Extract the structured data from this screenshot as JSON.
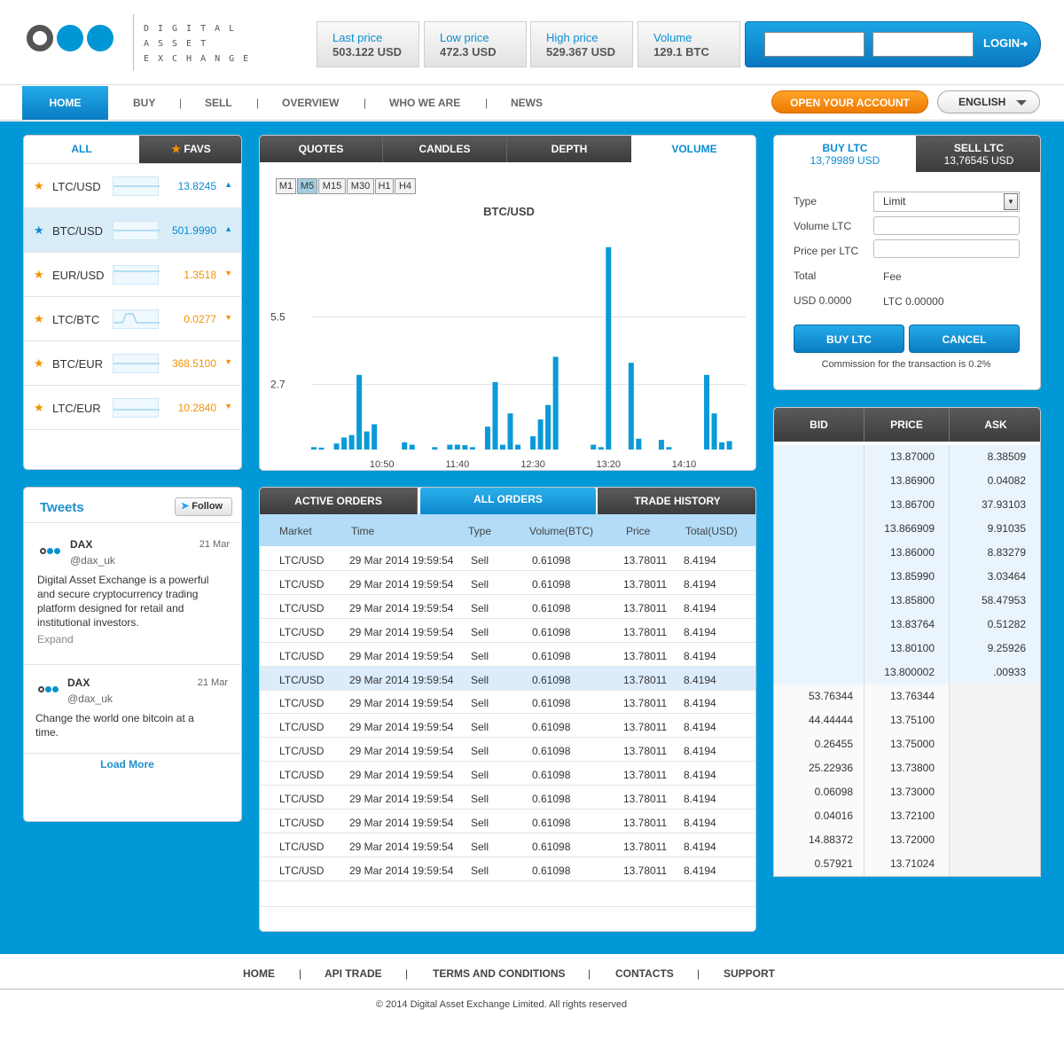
{
  "brand": {
    "logo_lines": [
      "DIGITAL",
      "ASSET",
      "EXCHANGE"
    ]
  },
  "stats": [
    {
      "label": "Last price",
      "value": "503.122 USD"
    },
    {
      "label": "Low price",
      "value": "472.3 USD"
    },
    {
      "label": "High price",
      "value": "529.367 USD"
    },
    {
      "label": "Volume",
      "value": "129.1 BTC"
    }
  ],
  "login": {
    "button": "LOGIN",
    "arrow_icon": "arrow-right-icon"
  },
  "nav": {
    "home": "HOME",
    "items": [
      "BUY",
      "SELL",
      "OVERVIEW",
      "WHO WE ARE",
      "NEWS"
    ],
    "separator": "|",
    "open_account": "OPEN YOUR ACCOUNT",
    "language": "ENGLISH"
  },
  "markets": {
    "tabs": {
      "all": "ALL",
      "favs": "FAVS"
    },
    "rows": [
      {
        "pair": "LTC/USD",
        "price": "13.8245",
        "dir": "up"
      },
      {
        "pair": "BTC/USD",
        "price": "501.9990",
        "dir": "up"
      },
      {
        "pair": "EUR/USD",
        "price": "1.3518",
        "dir": "down"
      },
      {
        "pair": "LTC/BTC",
        "price": "0.0277",
        "dir": "down"
      },
      {
        "pair": "BTC/EUR",
        "price": "368.5100",
        "dir": "down"
      },
      {
        "pair": "LTC/EUR",
        "price": "10.2840",
        "dir": "down"
      }
    ],
    "colors": {
      "up": "#0b8cd1",
      "down": "#f39200",
      "star": "#f39200",
      "star_selected": "#0b8cd1"
    }
  },
  "tweets": {
    "title": "Tweets",
    "follow": "Follow",
    "items": [
      {
        "name": "DAX",
        "handle": "@dax_uk",
        "date": "21 Mar",
        "text_lines": [
          "Digital Asset Exchange is a powerful",
          "and secure cryptocurrency trading",
          "platform designed for retail and",
          "institutional investors."
        ],
        "expand": "Expand"
      },
      {
        "name": "DAX",
        "handle": "@dax_uk",
        "date": "21 Mar",
        "text_lines": [
          "Change the world one bitcoin at a",
          "time."
        ],
        "expand": ""
      }
    ],
    "load_more": "Load More"
  },
  "chart_tabs": [
    "QUOTES",
    "CANDLES",
    "DEPTH",
    "VOLUME"
  ],
  "timeframes": [
    "M1",
    "M5",
    "M15",
    "M30",
    "H1",
    "H4"
  ],
  "timeframe_active": "M5",
  "chart_data": {
    "type": "bar",
    "title": "BTC/USD",
    "xlabel": "",
    "ylabel": "",
    "ylim": [
      0,
      9.2
    ],
    "yticks": [
      2.7,
      5.5
    ],
    "xticks": [
      {
        "label": "10:50",
        "t": 9
      },
      {
        "label": "11:40",
        "t": 19
      },
      {
        "label": "12:30",
        "t": 29
      },
      {
        "label": "13:20",
        "t": 39
      },
      {
        "label": "14:10",
        "t": 49
      }
    ],
    "grid": true,
    "x": [
      0,
      1,
      3,
      4,
      5,
      6,
      7,
      8,
      12,
      13,
      16,
      18,
      19,
      20,
      21,
      23,
      24,
      25,
      26,
      27,
      29,
      30,
      31,
      32,
      37,
      38,
      39,
      42,
      43,
      46,
      47,
      52,
      53,
      54,
      55
    ],
    "values": [
      0.1,
      0.08,
      0.25,
      0.5,
      0.6,
      3.1,
      0.75,
      1.05,
      0.3,
      0.2,
      0.1,
      0.2,
      0.2,
      0.18,
      0.1,
      0.95,
      2.8,
      0.2,
      1.5,
      0.2,
      0.55,
      1.25,
      1.85,
      3.85,
      0.2,
      0.1,
      8.4,
      3.6,
      0.45,
      0.4,
      0.1,
      3.1,
      1.5,
      0.3,
      0.35
    ]
  },
  "trade": {
    "buy_tab": {
      "title": "BUY LTC",
      "price": "13,79989 USD"
    },
    "sell_tab": {
      "title": "SELL LTC",
      "price": "13,76545 USD"
    },
    "type_label": "Type",
    "type_value": "Limit",
    "volume_label": "Volume LTC",
    "price_label": "Price per LTC",
    "total_label": "Total",
    "fee_label": "Fee",
    "total_value": "USD 0.0000",
    "fee_value": "LTC 0.00000",
    "buy_button": "BUY LTC",
    "cancel_button": "CANCEL",
    "commission": "Commission for the transaction is 0.2%"
  },
  "book": {
    "headers": [
      "BID",
      "PRICE",
      "ASK"
    ],
    "asks": [
      {
        "bid": "",
        "price": "13.87000",
        "ask": "8.38509"
      },
      {
        "bid": "",
        "price": "13.86900",
        "ask": "0.04082"
      },
      {
        "bid": "",
        "price": "13.86700",
        "ask": "37.93103"
      },
      {
        "bid": "",
        "price": "13.866909",
        "ask": "9.91035"
      },
      {
        "bid": "",
        "price": "13.86000",
        "ask": "8.83279"
      },
      {
        "bid": "",
        "price": "13.85990",
        "ask": "3.03464"
      },
      {
        "bid": "",
        "price": "13.85800",
        "ask": "58.47953"
      },
      {
        "bid": "",
        "price": "13.83764",
        "ask": "0.51282"
      },
      {
        "bid": "",
        "price": "13.80100",
        "ask": "9.25926"
      },
      {
        "bid": "",
        "price": "13.800002",
        "ask": ".00933"
      }
    ],
    "bids": [
      {
        "bid": "53.76344",
        "price": "13.76344",
        "ask": ""
      },
      {
        "bid": "44.44444",
        "price": "13.75100",
        "ask": ""
      },
      {
        "bid": "0.26455",
        "price": "13.75000",
        "ask": ""
      },
      {
        "bid": "25.22936",
        "price": "13.73800",
        "ask": ""
      },
      {
        "bid": "0.06098",
        "price": "13.73000",
        "ask": ""
      },
      {
        "bid": "0.04016",
        "price": "13.72100",
        "ask": ""
      },
      {
        "bid": "14.88372",
        "price": "13.72000",
        "ask": ""
      },
      {
        "bid": "0.57921",
        "price": "13.71024",
        "ask": ""
      }
    ]
  },
  "orders": {
    "tabs": [
      "ACTIVE ORDERS",
      "ALL ORDERS",
      "TRADE HISTORY"
    ],
    "active_tab": "ALL ORDERS",
    "columns": [
      "Market",
      "Time",
      "Type",
      "Volume(BTC)",
      "Price",
      "Total(USD)"
    ],
    "rows": [
      [
        "LTC/USD",
        "29 Mar 2014 19:59:54",
        "Sell",
        "0.61098",
        "13.78011",
        "8.4194"
      ],
      [
        "LTC/USD",
        "29 Mar 2014 19:59:54",
        "Sell",
        "0.61098",
        "13.78011",
        "8.4194"
      ],
      [
        "LTC/USD",
        "29 Mar 2014 19:59:54",
        "Sell",
        "0.61098",
        "13.78011",
        "8.4194"
      ],
      [
        "LTC/USD",
        "29 Mar 2014 19:59:54",
        "Sell",
        "0.61098",
        "13.78011",
        "8.4194"
      ],
      [
        "LTC/USD",
        "29 Mar 2014 19:59:54",
        "Sell",
        "0.61098",
        "13.78011",
        "8.4194"
      ],
      [
        "LTC/USD",
        "29 Mar 2014 19:59:54",
        "Sell",
        "0.61098",
        "13.78011",
        "8.4194"
      ],
      [
        "LTC/USD",
        "29 Mar 2014 19:59:54",
        "Sell",
        "0.61098",
        "13.78011",
        "8.4194"
      ],
      [
        "LTC/USD",
        "29 Mar 2014 19:59:54",
        "Sell",
        "0.61098",
        "13.78011",
        "8.4194"
      ],
      [
        "LTC/USD",
        "29 Mar 2014 19:59:54",
        "Sell",
        "0.61098",
        "13.78011",
        "8.4194"
      ],
      [
        "LTC/USD",
        "29 Mar 2014 19:59:54",
        "Sell",
        "0.61098",
        "13.78011",
        "8.4194"
      ],
      [
        "LTC/USD",
        "29 Mar 2014 19:59:54",
        "Sell",
        "0.61098",
        "13.78011",
        "8.4194"
      ],
      [
        "LTC/USD",
        "29 Mar 2014 19:59:54",
        "Sell",
        "0.61098",
        "13.78011",
        "8.4194"
      ],
      [
        "LTC/USD",
        "29 Mar 2014 19:59:54",
        "Sell",
        "0.61098",
        "13.78011",
        "8.4194"
      ],
      [
        "LTC/USD",
        "29 Mar 2014 19:59:54",
        "Sell",
        "0.61098",
        "13.78011",
        "8.4194"
      ]
    ],
    "highlighted_row": 5
  },
  "footer": {
    "links": [
      "HOME",
      "API TRADE",
      "TERMS AND CONDITIONS",
      "CONTACTS",
      "SUPPORT"
    ],
    "separator": "|",
    "copyright": "© 2014 Digital Asset Exchange Limited. All rights reserved"
  },
  "colors": {
    "accent": "#0098d6",
    "orange": "#f39200",
    "dark_tab": "#444444",
    "bar": "#0a9ad8"
  }
}
